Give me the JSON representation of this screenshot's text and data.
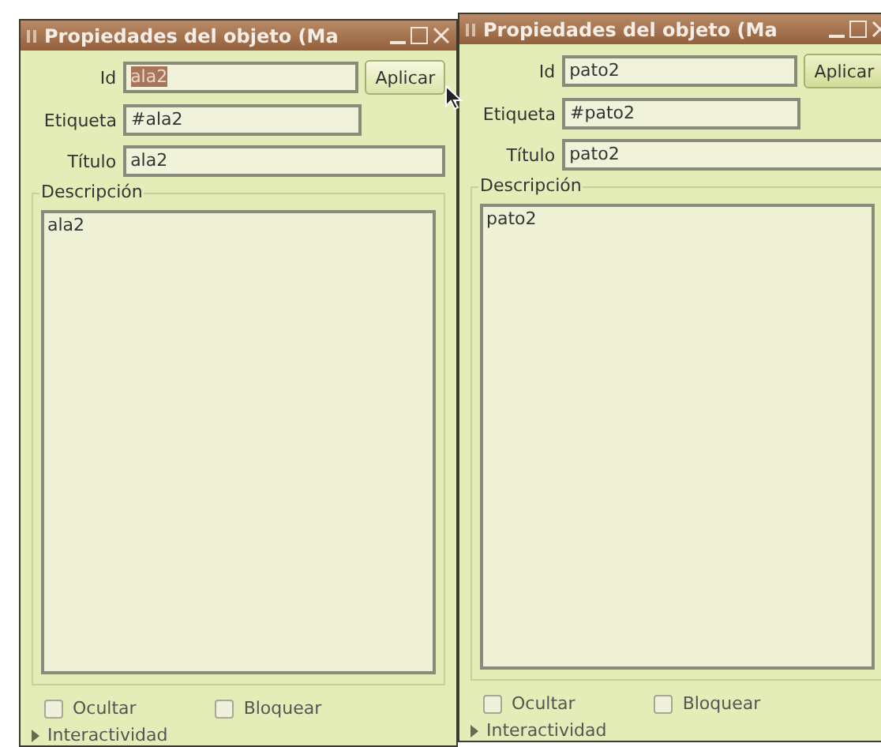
{
  "windows": [
    {
      "title": "Propiedades del objeto (Ma",
      "id_label": "Id",
      "id_value": "ala2",
      "id_text_selected": true,
      "apply_button": "Aplicar",
      "pointer_over_apply": true,
      "tag_label": "Etiqueta",
      "tag_value": "#ala2",
      "title_label": "Título",
      "title_value": "ala2",
      "description_label": "Descripción",
      "description_value": "ala2",
      "checkboxes": [
        {
          "label": "Ocultar",
          "checked": false
        },
        {
          "label": "Bloquear",
          "checked": false
        }
      ],
      "expander": {
        "label": "Interactividad",
        "expanded": false
      }
    },
    {
      "title": "Propiedades del objeto (Ma",
      "id_label": "Id",
      "id_value": "pato2",
      "id_text_selected": false,
      "apply_button": "Aplicar",
      "pointer_over_apply": false,
      "tag_label": "Etiqueta",
      "tag_value": "#pato2",
      "title_label": "Título",
      "title_value": "pato2",
      "description_label": "Descripción",
      "description_value": "pato2",
      "checkboxes": [
        {
          "label": "Ocultar",
          "checked": false
        },
        {
          "label": "Bloquear",
          "checked": false
        }
      ],
      "expander": {
        "label": "Interactividad",
        "expanded": false
      }
    }
  ]
}
